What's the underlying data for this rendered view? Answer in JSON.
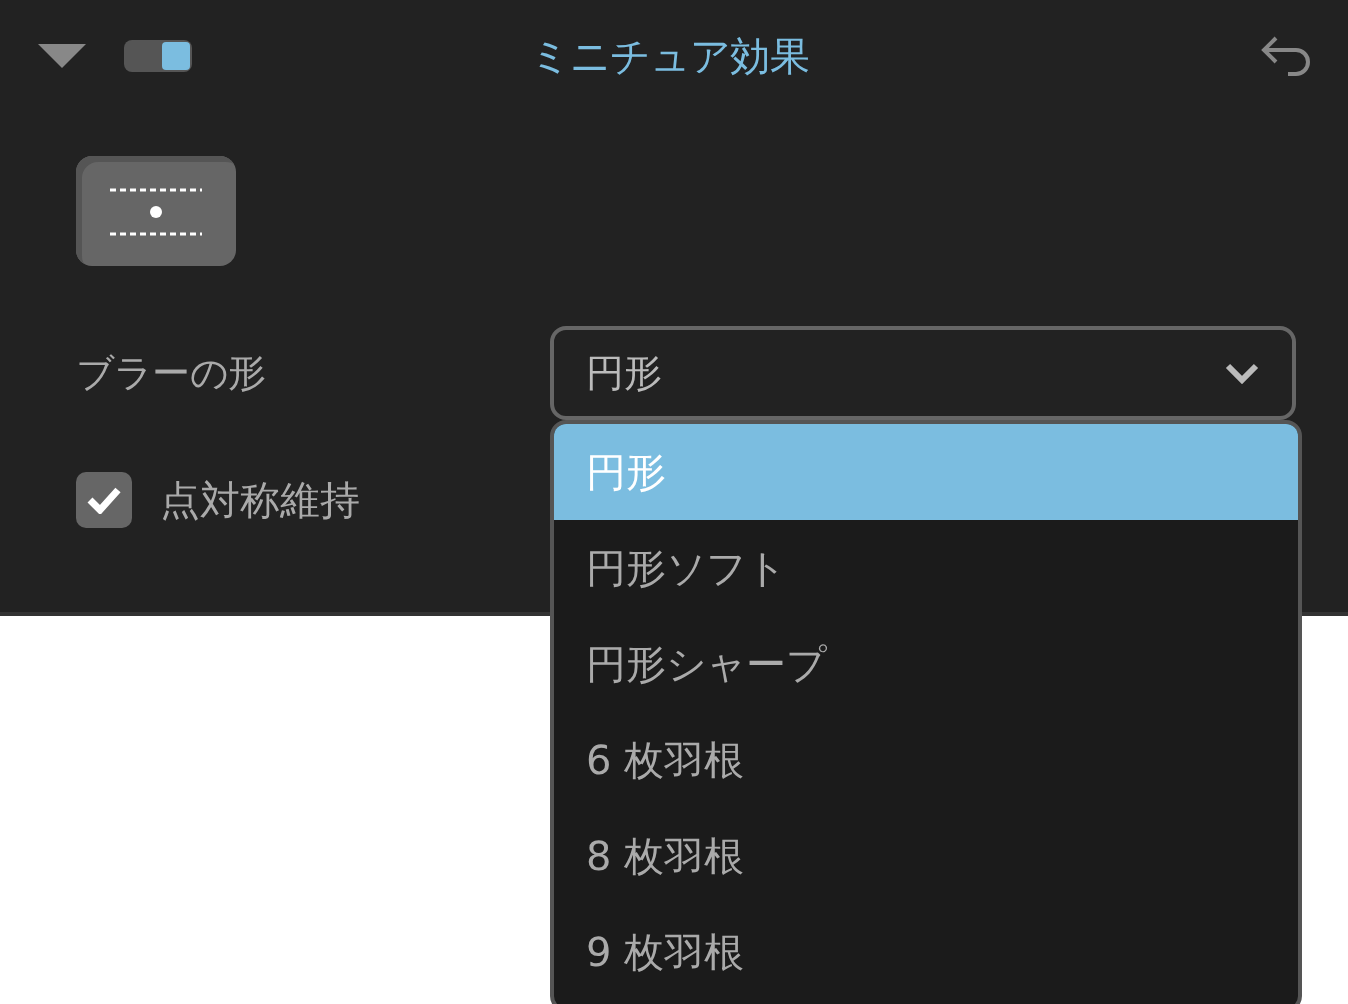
{
  "header": {
    "title": "ミニチュア効果",
    "enabled": true,
    "expanded": true
  },
  "blur_shape": {
    "label": "ブラーの形",
    "value": "円形",
    "expanded": true,
    "options": [
      {
        "label": "円形",
        "selected": true
      },
      {
        "label": "円形ソフト",
        "selected": false
      },
      {
        "label": "円形シャープ",
        "selected": false
      },
      {
        "label": "6 枚羽根",
        "selected": false
      },
      {
        "label": "8 枚羽根",
        "selected": false
      },
      {
        "label": "9 枚羽根",
        "selected": false
      }
    ]
  },
  "symmetry": {
    "label": "点対称維持",
    "checked": true
  }
}
